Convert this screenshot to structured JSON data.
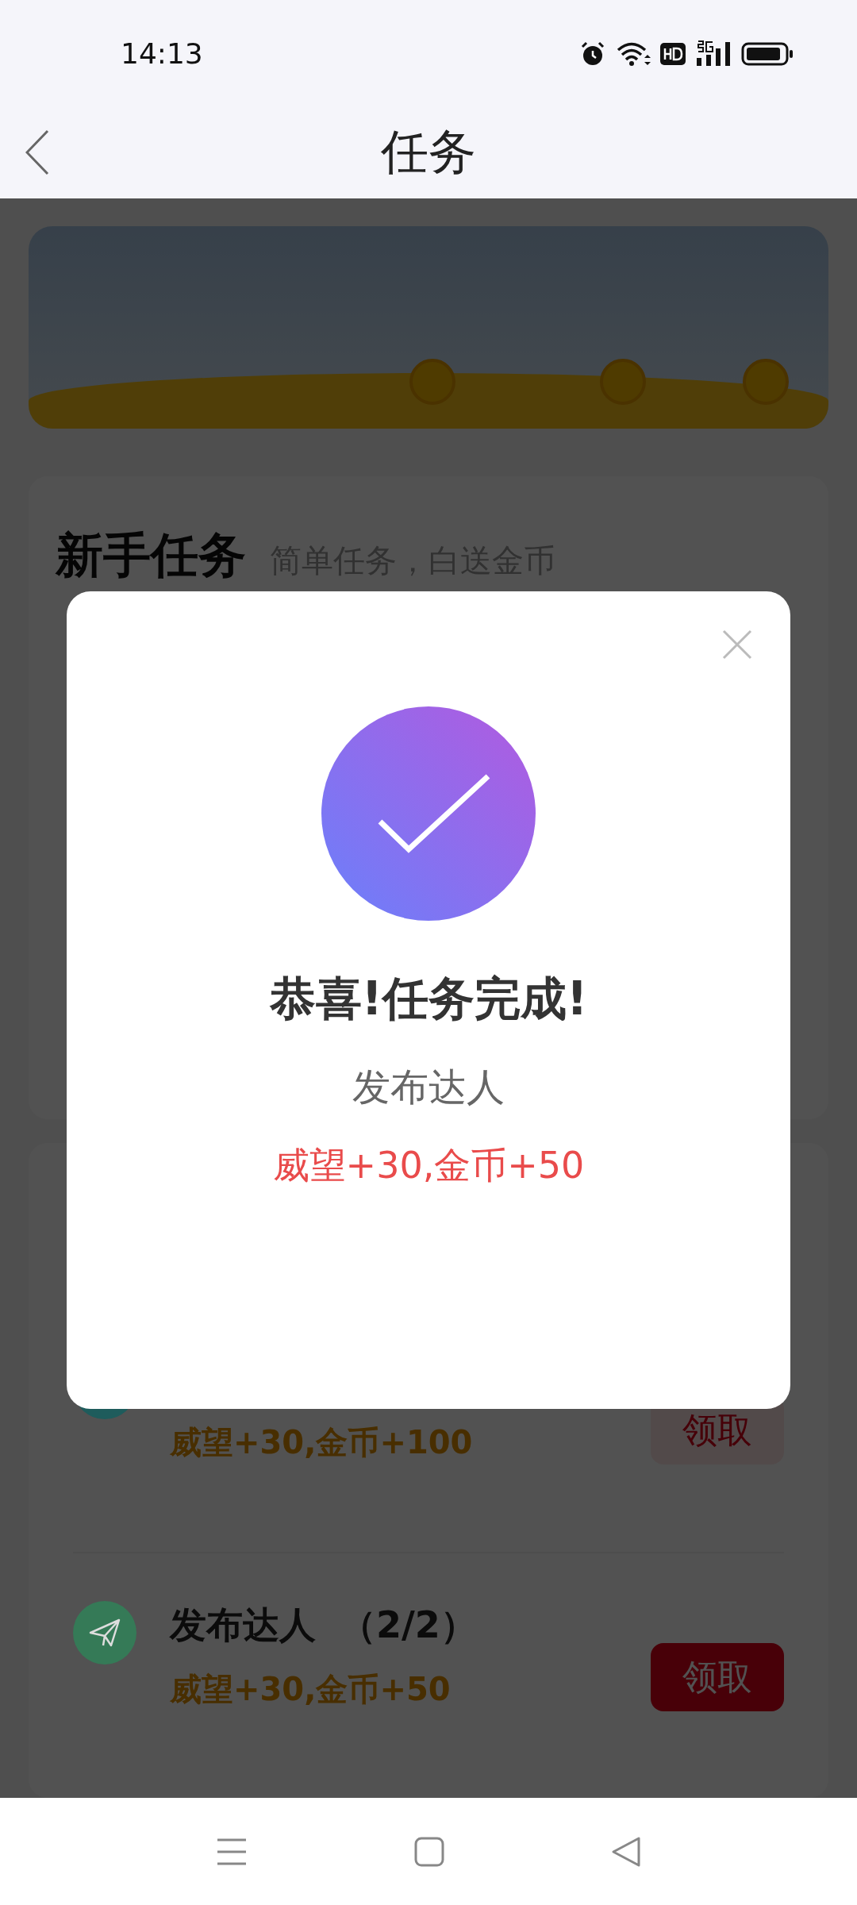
{
  "status_bar": {
    "time": "14:13"
  },
  "header": {
    "title": "任务"
  },
  "newbie_section": {
    "title": "新手任务",
    "subtitle": "简单任务，白送金币"
  },
  "tasks": [
    {
      "color": "#1e5c5c",
      "reward": "威望+30,金币+100",
      "button": "领取",
      "claimable": false
    },
    {
      "color": "#357a57",
      "title": "发布达人",
      "progress": "（2/2）",
      "reward": "威望+30,金币+50",
      "button": "领取",
      "claimable": true
    }
  ],
  "dialog": {
    "title": "恭喜!任务完成!",
    "task_name": "发布达人",
    "reward": "威望+30,金币+50"
  }
}
